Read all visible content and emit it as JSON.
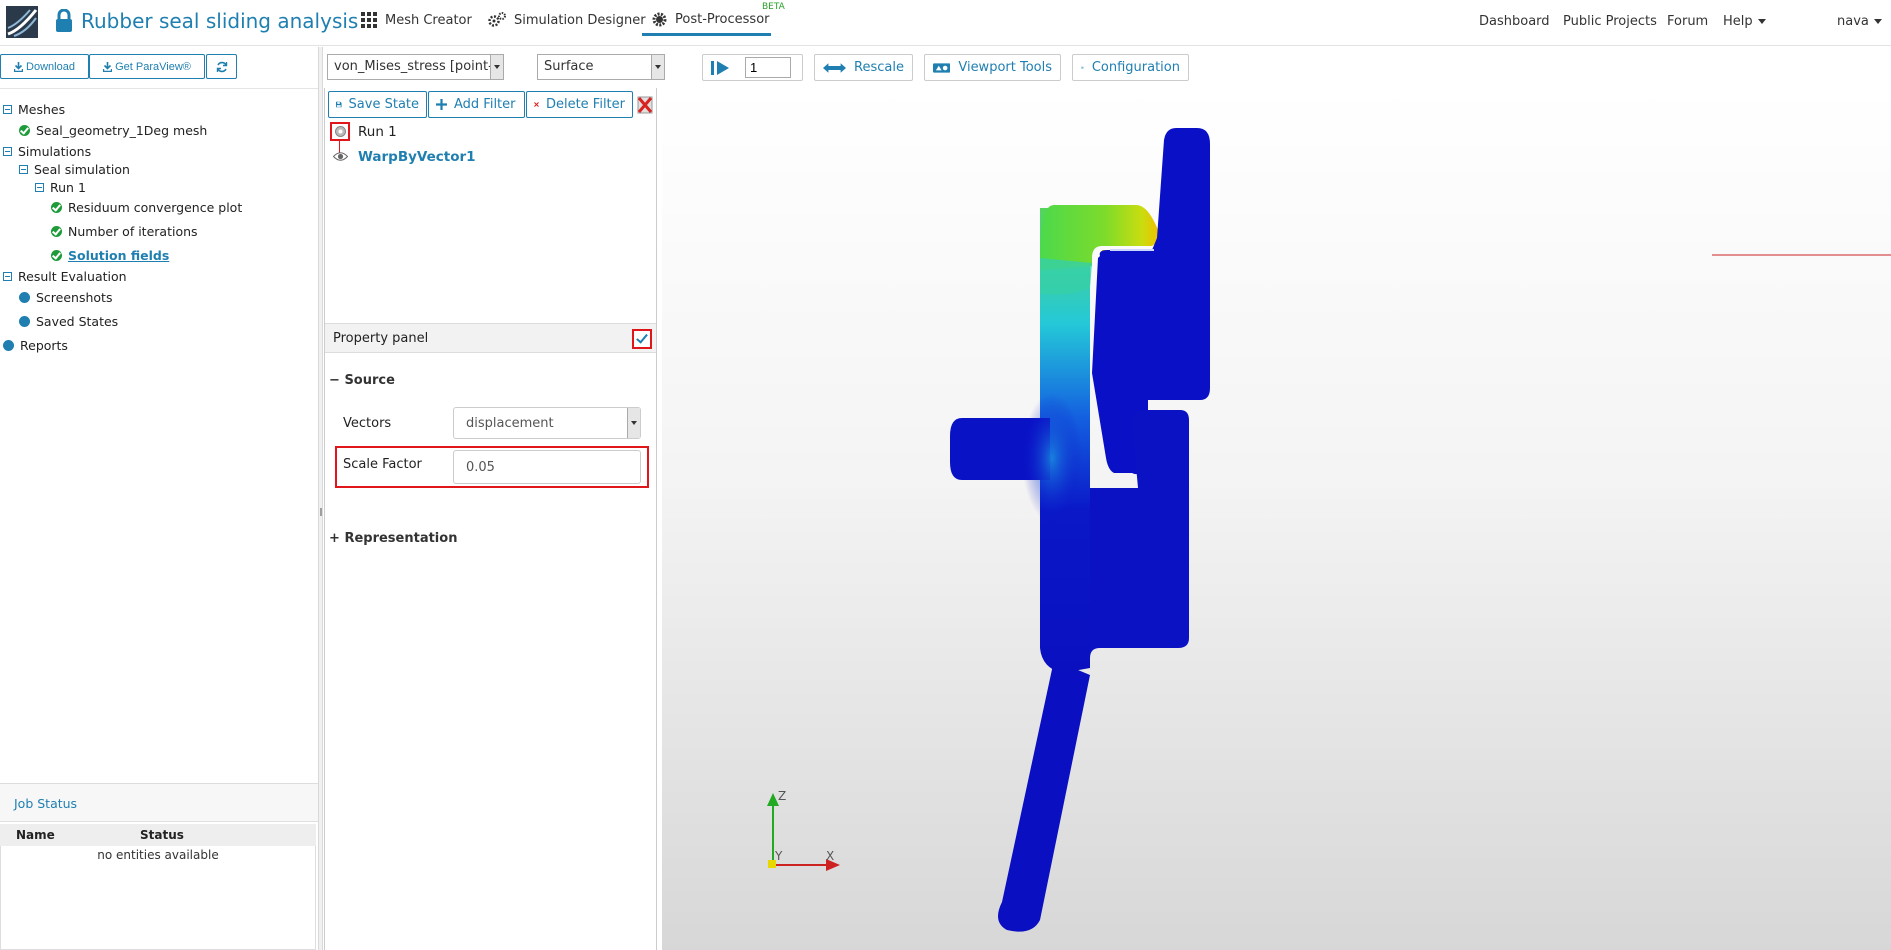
{
  "header": {
    "project_title": "Rubber seal sliding analysis",
    "nav": [
      {
        "label": "Mesh Creator"
      },
      {
        "label": "Simulation Designer"
      },
      {
        "label": "Post-Processor"
      }
    ],
    "beta_badge": "BETA",
    "right_links": [
      {
        "label": "Dashboard"
      },
      {
        "label": "Public Projects"
      },
      {
        "label": "Forum"
      },
      {
        "label": "Help"
      },
      {
        "label": "nava"
      }
    ]
  },
  "sidebar": {
    "buttons": {
      "download": "Download",
      "paraview": "Get ParaView®"
    },
    "tree": {
      "meshes": "Meshes",
      "mesh_item": "Seal_geometry_1Deg mesh",
      "simulations": "Simulations",
      "seal_simulation": "Seal simulation",
      "run": "Run 1",
      "residuum": "Residuum convergence plot",
      "iterations": "Number of iterations",
      "solution_fields": "Solution fields",
      "result_evaluation": "Result Evaluation",
      "screenshots": "Screenshots",
      "saved_states": "Saved States",
      "reports": "Reports"
    },
    "job_status": {
      "title": "Job Status",
      "columns": [
        "Name",
        "Status"
      ],
      "empty_text": "no entities available"
    }
  },
  "toolbar": {
    "field_select": "von_Mises_stress [point-data]",
    "representation_select": "Surface",
    "frame_value": "1",
    "rescale": "Rescale",
    "viewport_tools": "Viewport Tools",
    "configuration": "Configuration"
  },
  "pipeline": {
    "save_state": "Save State",
    "add_filter": "Add Filter",
    "delete_filter": "Delete Filter",
    "items": [
      {
        "label": "Run 1"
      },
      {
        "label": "WarpByVector1"
      }
    ]
  },
  "property_panel": {
    "title": "Property panel",
    "source_section": "Source",
    "vectors_label": "Vectors",
    "vectors_value": "displacement",
    "scale_factor_label": "Scale Factor",
    "scale_factor_value": "0.05",
    "representation_section": "Representation"
  },
  "viewport": {
    "axis_labels": {
      "z": "Z",
      "x": "X",
      "y": "Y"
    },
    "colors": {
      "high": "#f0c000",
      "mid": "#4cd94c",
      "low": "#0a10c8",
      "cyan": "#28d6d0"
    }
  }
}
